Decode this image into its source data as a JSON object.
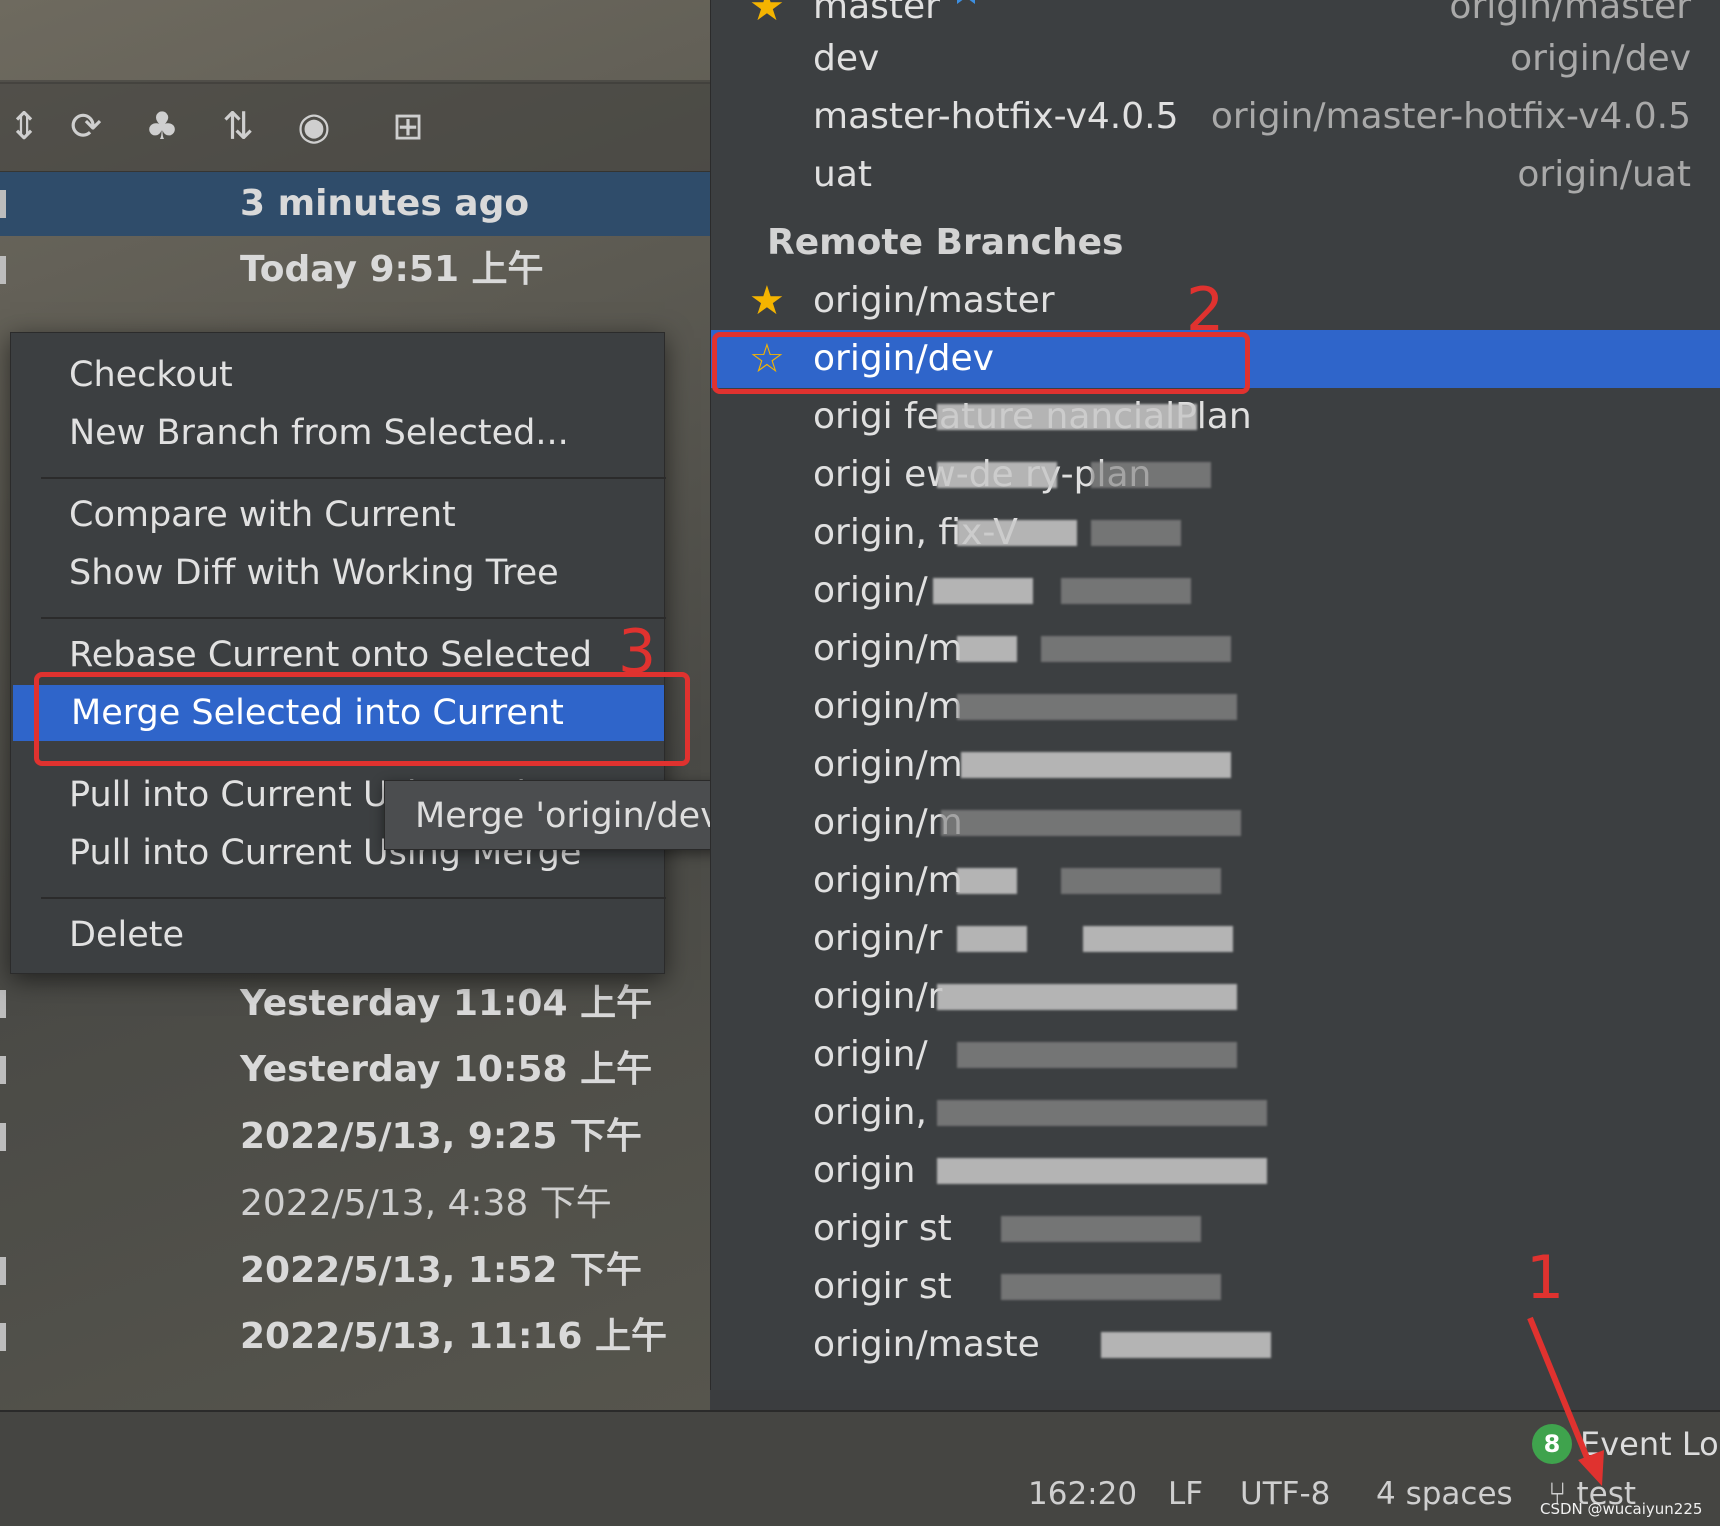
{
  "toolbar": {
    "icons": [
      "sort-icon",
      "refresh-icon",
      "cherry-pick-icon",
      "expand-icon",
      "eye-icon",
      "add-tab-icon"
    ]
  },
  "history": {
    "rows": [
      {
        "time": "3 minutes ago"
      },
      {
        "time": "Today 9:51 上午"
      },
      {
        "time": "Yesterday 11:04 上午"
      },
      {
        "time": "Yesterday 10:58 上午"
      },
      {
        "time": "2022/5/13, 9:25 下午"
      },
      {
        "time": "2022/5/13, 4:38 下午"
      },
      {
        "time": "2022/5/13, 1:52 下午"
      },
      {
        "time": "2022/5/13, 11:16 上午"
      }
    ]
  },
  "context_menu": {
    "items": [
      {
        "label": "Checkout"
      },
      {
        "label": "New Branch from Selected..."
      },
      {
        "label": "Compare with Current"
      },
      {
        "label": "Show Diff with Working Tree"
      },
      {
        "label": "Rebase Current onto Selected"
      },
      {
        "label": "Merge Selected into Current"
      },
      {
        "label": "Pull into Current Using Rebase"
      },
      {
        "label": "Pull into Current Using Merge"
      },
      {
        "label": "Delete"
      }
    ],
    "active_index": 5
  },
  "tooltip": {
    "text": "Merge 'origin/dev' into 'test'"
  },
  "branches": {
    "local": [
      {
        "name": "master",
        "remote": "origin/master",
        "favorite": true
      },
      {
        "name": "dev",
        "remote": "origin/dev"
      },
      {
        "name": "master-hotfix-v4.0.5",
        "remote": "origin/master-hotfix-v4.0.5"
      },
      {
        "name": "uat",
        "remote": "origin/uat"
      }
    ],
    "remote_header": "Remote Branches",
    "remote": [
      {
        "name": "origin/master",
        "favorite": true
      },
      {
        "name": "origin/dev",
        "favorite": false,
        "selected": true
      },
      {
        "name": "origi  feature  nancialPlan"
      },
      {
        "name": "origi          ew-de   ry-plan"
      },
      {
        "name": "origin,        fix-V"
      },
      {
        "name": "origin/"
      },
      {
        "name": "origin/m"
      },
      {
        "name": "origin/m"
      },
      {
        "name": "origin/m"
      },
      {
        "name": "origin/m"
      },
      {
        "name": "origin/m"
      },
      {
        "name": "origin/r"
      },
      {
        "name": "origin/r"
      },
      {
        "name": "origin/"
      },
      {
        "name": "origin,"
      },
      {
        "name": "origin"
      },
      {
        "name": "origir      st"
      },
      {
        "name": "origir      st"
      },
      {
        "name": "origin/maste"
      }
    ]
  },
  "status_bar": {
    "position": "162:20",
    "line_sep": "LF",
    "encoding": "UTF-8",
    "indent": "4 spaces",
    "branch": "test",
    "event_count": "8",
    "event_log": "Event Log"
  },
  "annotations": {
    "n1": "1",
    "n2": "2",
    "n3": "3"
  },
  "watermark": "CSDN @wucaiyun225",
  "colors": {
    "selection": "#2f65ca",
    "annotation": "#e0322f",
    "star": "#f4b400"
  }
}
